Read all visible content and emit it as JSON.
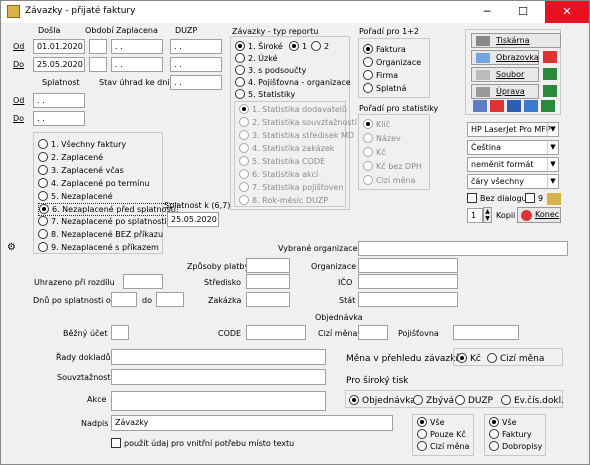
{
  "window": {
    "title": "Závazky - přijaté faktury",
    "minimize": "─",
    "maximize": "☐",
    "close": "✕"
  },
  "dates": {
    "dosla": "Došla",
    "obdobi": "Období",
    "zaplacena": "Zaplacena",
    "duzp": "DUZP",
    "od": "Od",
    "do": "Do",
    "od_value": "01.01.2020",
    "do_value": "25.05.2020",
    "empty": ". .",
    "splatnost": "Splatnost",
    "stav_uhrad": "Stav úhrad ke dni"
  },
  "filter": {
    "options": [
      "1. Všechny faktury",
      "2. Zaplacené",
      "3. Zaplacené včas",
      "4. Zaplacené po termínu",
      "5. Nezaplacené",
      "6. Nezaplacené před splatností",
      "7. Nezaplacené po splatnosti",
      "8. Nezaplacené BEZ příkazu",
      "9. Nezaplacené s příkazem"
    ],
    "selected": 5,
    "splatnost_k": "Splatnost k (6,7)",
    "splatnost_k_value": "25.05.2020"
  },
  "report_type": {
    "title": "Závazky - typ reportu",
    "options": [
      "1. Široké",
      "2. Úzké",
      "3. s podsoučty",
      "4. Pojišťovna - organizace",
      "5. Statistiky"
    ],
    "sub_options": [
      "1",
      "2"
    ],
    "stats": [
      "1. Statistika dodavatelů",
      "2. Statistika souvztažností",
      "3. Statistika středisek MD",
      "4. Statistika zakázek",
      "5. Statistika CODE",
      "6. Statistika akcí",
      "7. Statistika pojišťoven",
      "8. Rok-měsíc DUZP"
    ]
  },
  "order12": {
    "title": "Pořadí pro 1+2",
    "options": [
      "Faktura",
      "Organizace",
      "Firma",
      "Splatná"
    ]
  },
  "order_stats": {
    "title": "Pořadí pro statistiky",
    "options": [
      "Klíč",
      "Název",
      "Kč",
      "Kč bez DPH",
      "Cizí měna"
    ]
  },
  "output": {
    "tiskarna": "Tiskárna",
    "obrazovka": "Obrazovka",
    "soubor": "Soubor",
    "uprava": "Úprava report",
    "printer": "HP LaserJet Pro MFP",
    "language": "Čeština",
    "format": "neměnit formát",
    "lines": "čáry všechny",
    "bez_dialogu": "Bez dialogu",
    "nine": "9",
    "kopii_value": "1",
    "kopii": "Kopii",
    "konec": "Konec"
  },
  "fields": {
    "vybrane_organizace": "Vybrané organizace",
    "zpusoby_platby": "Způsoby platby",
    "organizace": "Organizace",
    "uhrazeno": "Uhrazeno při rozdílu",
    "stredisko": "Středisko",
    "ico": "IČO",
    "dnu_po_splatnosti": "Dnů po splatnosti od",
    "do": "do",
    "zakazka": "Zakázka",
    "stat": "Stát",
    "objednavka": "Objednávka",
    "bezny_ucet": "Běžný účet",
    "code": "CODE",
    "cizi_mena": "Cizí měna",
    "pojistovna": "Pojišťovna",
    "rady_dokladu": "Řady dokladů",
    "souvztaznosti": "Souvztažnosti",
    "akce": "Akce",
    "nadpis": "Nadpis",
    "nadpis_value": "Závazky",
    "pouzit": "použít údaj pro vnitřní potřebu místo textu"
  },
  "currency": {
    "label": "Měna v přehledu závazků",
    "kc": "Kč",
    "cizi": "Cizí měna"
  },
  "wide": {
    "label": "Pro široký tisk",
    "options": [
      "Objednávka",
      "Zbývá",
      "DUZP",
      "Ev.čís.dokl."
    ]
  },
  "bottom1": {
    "options": [
      "Vše",
      "Pouze Kč",
      "Cizí měna"
    ]
  },
  "bottom2": {
    "options": [
      "Vše",
      "Faktury",
      "Dobropisy"
    ]
  },
  "colors": {
    "close": "#e81123",
    "selection": "#cce8ff"
  }
}
